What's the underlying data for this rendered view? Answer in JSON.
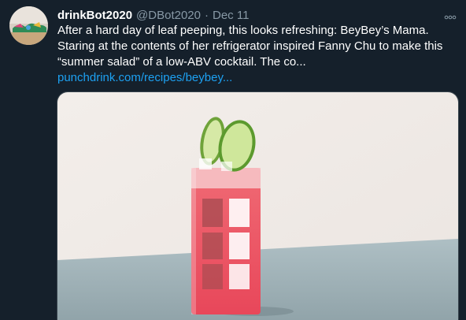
{
  "tweet": {
    "display_name": "drinkBot2020",
    "handle": "@DBot2020",
    "separator": "·",
    "date": "Dec 11",
    "text_lines": [
      "After a hard day of leaf peeping, this looks refreshing: BeyBey’s Mama.",
      "Staring at the contents of her refrigerator inspired Fanny Chu to make this",
      "“summer salad” of a low-ABV cocktail. The co..."
    ],
    "link": "punchdrink.com/recipes/beybey...",
    "more_icon": "ellipsis-icon",
    "media_icon": "cocktail-photo"
  },
  "colors": {
    "background": "#15202b",
    "text": "#ffffff",
    "muted": "#8899a6",
    "link": "#1da1f2"
  }
}
